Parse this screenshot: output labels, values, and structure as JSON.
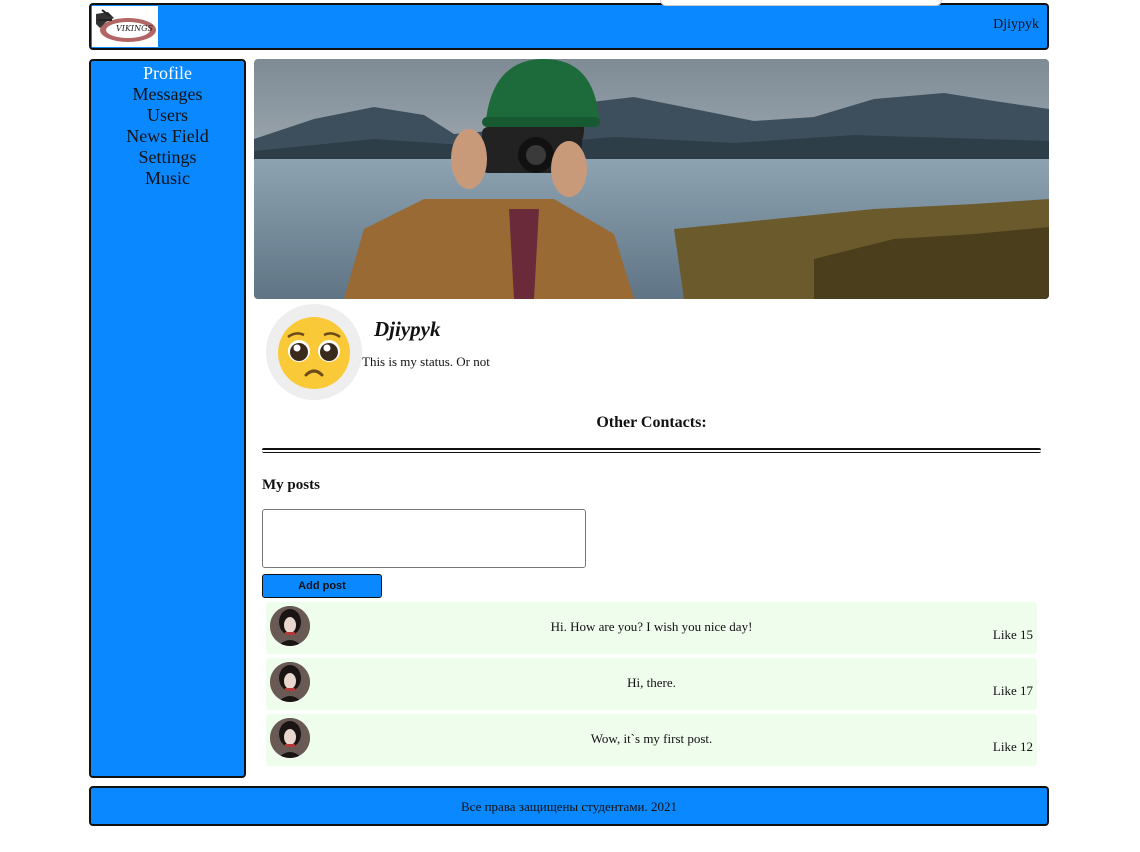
{
  "header": {
    "username": "Djiypyk",
    "logo_icon": "vikings-logo-icon"
  },
  "sidebar": {
    "items": [
      {
        "label": "Profile",
        "active": true
      },
      {
        "label": "Messages"
      },
      {
        "label": "Users"
      },
      {
        "label": "News Field"
      },
      {
        "label": "Settings"
      },
      {
        "label": "Music"
      }
    ]
  },
  "profile": {
    "name": "Djiypyk",
    "status": "This is my status. Or not",
    "avatar_icon": "pleading-face-emoji-icon",
    "other_contacts": "Other Contacts:"
  },
  "posts_section": {
    "title": "My posts",
    "input_value": "",
    "add_button": "Add post",
    "posts": [
      {
        "text": "Hi. How are you? I wish you nice day!",
        "like": "Like 15"
      },
      {
        "text": "Hi, there.",
        "like": "Like 17"
      },
      {
        "text": "Wow, it`s my first post.",
        "like": "Like 12"
      }
    ]
  },
  "footer": {
    "text": "Все права защищены студентами. 2021"
  },
  "colors": {
    "accent": "#0a88ff",
    "post_bg": "#effdec"
  }
}
